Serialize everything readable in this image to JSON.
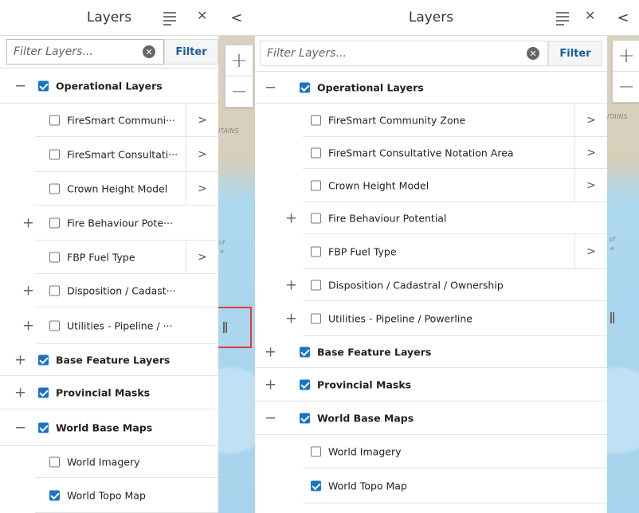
{
  "panel": {
    "title": "Layers",
    "filter_placeholder": "Filter Layers...",
    "filter_button": "Filter",
    "clear_glyph": "✕",
    "close_glyph": "✕",
    "collapse_glyph": "<",
    "chevron_glyph": ">",
    "zoom_in": "+",
    "zoom_out": "−"
  },
  "map_labels": [
    "ITAINS",
    "of",
    "a"
  ],
  "colors": {
    "accent": "#1873c9",
    "highlight": "#e23b3b",
    "filter_text": "#1a5d9a"
  },
  "left_layers": [
    {
      "name": "Operational Layers",
      "checked": true,
      "bold": true,
      "expander": "−"
    },
    {
      "name": "FireSmart Communi···",
      "checked": false,
      "chevron": true
    },
    {
      "name": "FireSmart Consultati···",
      "checked": false,
      "chevron": true
    },
    {
      "name": "Crown Height Model",
      "checked": false,
      "chevron": true
    },
    {
      "name": "Fire Behaviour Pote···",
      "checked": false,
      "expander": "+"
    },
    {
      "name": "FBP Fuel Type",
      "checked": false,
      "chevron": true
    },
    {
      "name": "Disposition / Cadast···",
      "checked": false,
      "expander": "+"
    },
    {
      "name": "Utilities - Pipeline / ···",
      "checked": false,
      "expander": "+"
    },
    {
      "name": "Base Feature Layers",
      "checked": true,
      "bold": true,
      "expander": "+"
    },
    {
      "name": "Provincial Masks",
      "checked": true,
      "bold": true,
      "expander": "+"
    },
    {
      "name": "World Base Maps",
      "checked": true,
      "bold": true,
      "expander": "−"
    },
    {
      "name": "World Imagery",
      "checked": false
    },
    {
      "name": "World Topo Map",
      "checked": true
    }
  ],
  "right_layers": [
    {
      "name": "Operational Layers",
      "checked": true,
      "bold": true,
      "expander": "−"
    },
    {
      "name": "FireSmart Community Zone",
      "checked": false,
      "chevron": true
    },
    {
      "name": "FireSmart Consultative Notation Area",
      "checked": false,
      "chevron": true
    },
    {
      "name": "Crown Height Model",
      "checked": false,
      "chevron": true
    },
    {
      "name": "Fire Behaviour Potential",
      "checked": false,
      "expander": "+"
    },
    {
      "name": "FBP Fuel Type",
      "checked": false,
      "chevron": true
    },
    {
      "name": "Disposition / Cadastral / Ownership",
      "checked": false,
      "expander": "+"
    },
    {
      "name": "Utilities - Pipeline / Powerline",
      "checked": false,
      "expander": "+"
    },
    {
      "name": "Base Feature Layers",
      "checked": true,
      "bold": true,
      "expander": "+"
    },
    {
      "name": "Provincial Masks",
      "checked": true,
      "bold": true,
      "expander": "+"
    },
    {
      "name": "World Base Maps",
      "checked": true,
      "bold": true,
      "expander": "−"
    },
    {
      "name": "World Imagery",
      "checked": false
    },
    {
      "name": "World Topo Map",
      "checked": true
    }
  ]
}
